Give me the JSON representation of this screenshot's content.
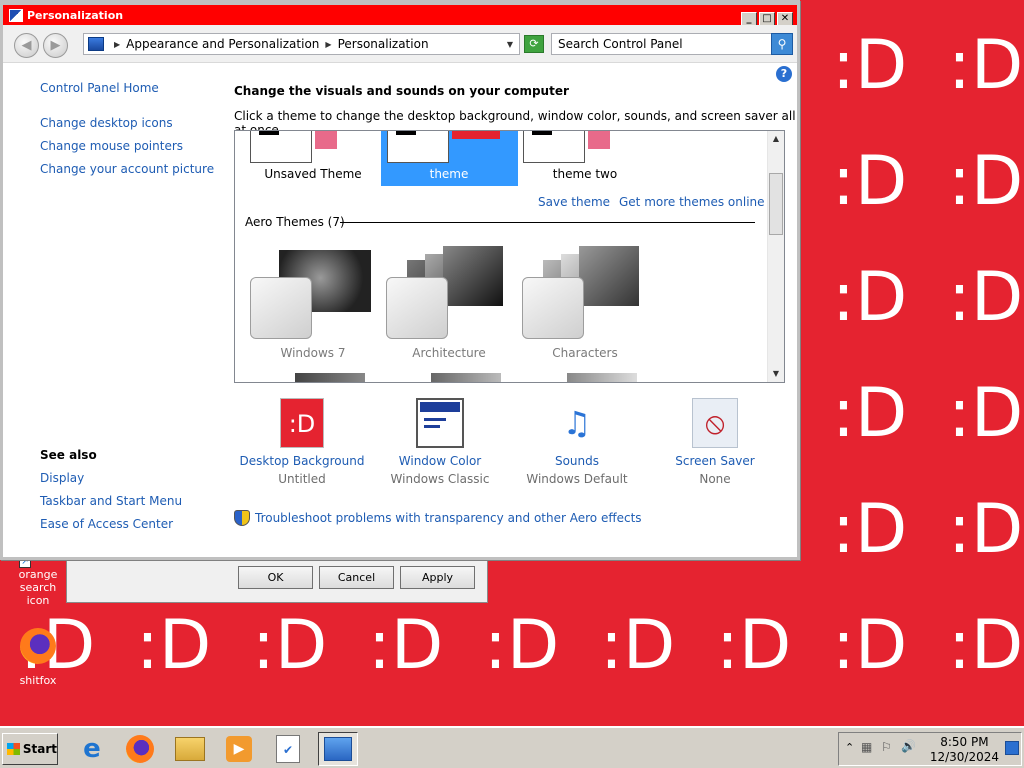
{
  "window": {
    "title": "Personalization",
    "min_glyph": "_",
    "max_glyph": "□",
    "close_glyph": "✕"
  },
  "nav": {
    "back_glyph": "◀",
    "forward_glyph": "▶",
    "breadcrumb": [
      "Appearance and Personalization",
      "Personalization"
    ],
    "search_placeholder": "Search Control Panel",
    "search_glyph": "⚲",
    "refresh_glyph": "⟳"
  },
  "left_pane": {
    "home": "Control Panel Home",
    "links": [
      "Change desktop icons",
      "Change mouse pointers",
      "Change your account picture"
    ],
    "see_also_heading": "See also",
    "see_also": [
      "Display",
      "Taskbar and Start Menu",
      "Ease of Access Center"
    ]
  },
  "main": {
    "heading": "Change the visuals and sounds on your computer",
    "subtext": "Click a theme to change the desktop background, window color, sounds, and screen saver all at once.",
    "help_glyph": "?",
    "my_themes": [
      "Unsaved Theme",
      "theme",
      "theme two"
    ],
    "selected_theme": "theme",
    "save_theme": "Save theme",
    "get_more": "Get more themes online",
    "aero_heading": "Aero Themes (7)",
    "aero_themes": [
      "Windows 7",
      "Architecture",
      "Characters"
    ],
    "scroll_up": "▲",
    "scroll_down": "▼"
  },
  "bottom": {
    "items": [
      {
        "label": "Desktop Background",
        "sub": "Untitled",
        "glyph": ":D"
      },
      {
        "label": "Window Color",
        "sub": "Windows Classic"
      },
      {
        "label": "Sounds",
        "sub": "Windows Default",
        "glyph": "♫"
      },
      {
        "label": "Screen Saver",
        "sub": "None",
        "glyph": "⦸"
      }
    ],
    "troubleshoot": "Troubleshoot problems with transparency and other Aero effects"
  },
  "behind_dialog": {
    "ok": "OK",
    "cancel": "Cancel",
    "apply": "Apply"
  },
  "desktop": {
    "smiley": ":D",
    "icons": [
      {
        "label_line1": "orange search",
        "label_line2": "icon"
      },
      {
        "label_line1": "shitfox",
        "label_line2": ""
      }
    ],
    "accent": "#e52330"
  },
  "taskbar": {
    "start": "Start",
    "time": "8:50 PM",
    "date": "12/30/2024",
    "tray_glyphs": [
      "⌃",
      "▦",
      "⚐",
      "🔊"
    ]
  }
}
